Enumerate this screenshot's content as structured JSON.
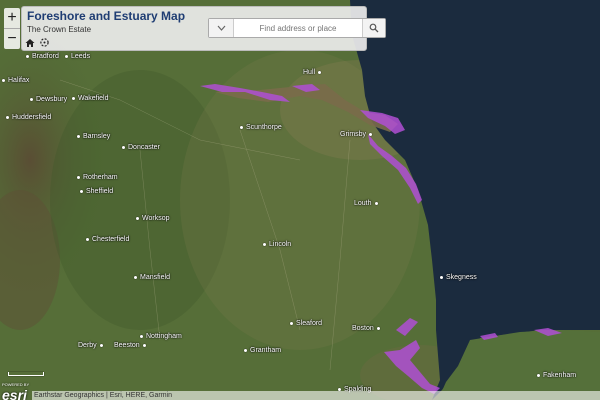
{
  "app": {
    "title": "Foreshore and Estuary Map",
    "subtitle": "The Crown Estate"
  },
  "controls": {
    "zoom_in": "+",
    "zoom_out": "−",
    "home_icon": "home-icon",
    "locate_icon": "locate-icon"
  },
  "search": {
    "placeholder": "Find address or place",
    "menu_icon": "chevron-down-icon",
    "search_icon": "search-icon"
  },
  "map": {
    "cities": [
      "Bradford",
      "Leeds",
      "Halifax",
      "Dewsbury",
      "Wakefield",
      "Huddersfield",
      "Barnsley",
      "Doncaster",
      "Rotherham",
      "Sheffield",
      "Worksop",
      "Chesterfield",
      "Mansfield",
      "Nottingham",
      "Derby",
      "Beeston",
      "Hull",
      "Scunthorpe",
      "Grimsby",
      "Louth",
      "Lincoln",
      "Skegness",
      "Sleaford",
      "Boston",
      "Grantham",
      "Spalding",
      "Fakenham"
    ],
    "colors": {
      "sea": "#1b2b3e",
      "land": "#4f6a34",
      "foreshore": "#b04fd4"
    }
  },
  "attribution": "Earthstar Geographics | Esri, HERE, Garmin",
  "logo": {
    "powered_by": "POWERED BY",
    "wordmark": "esri"
  }
}
